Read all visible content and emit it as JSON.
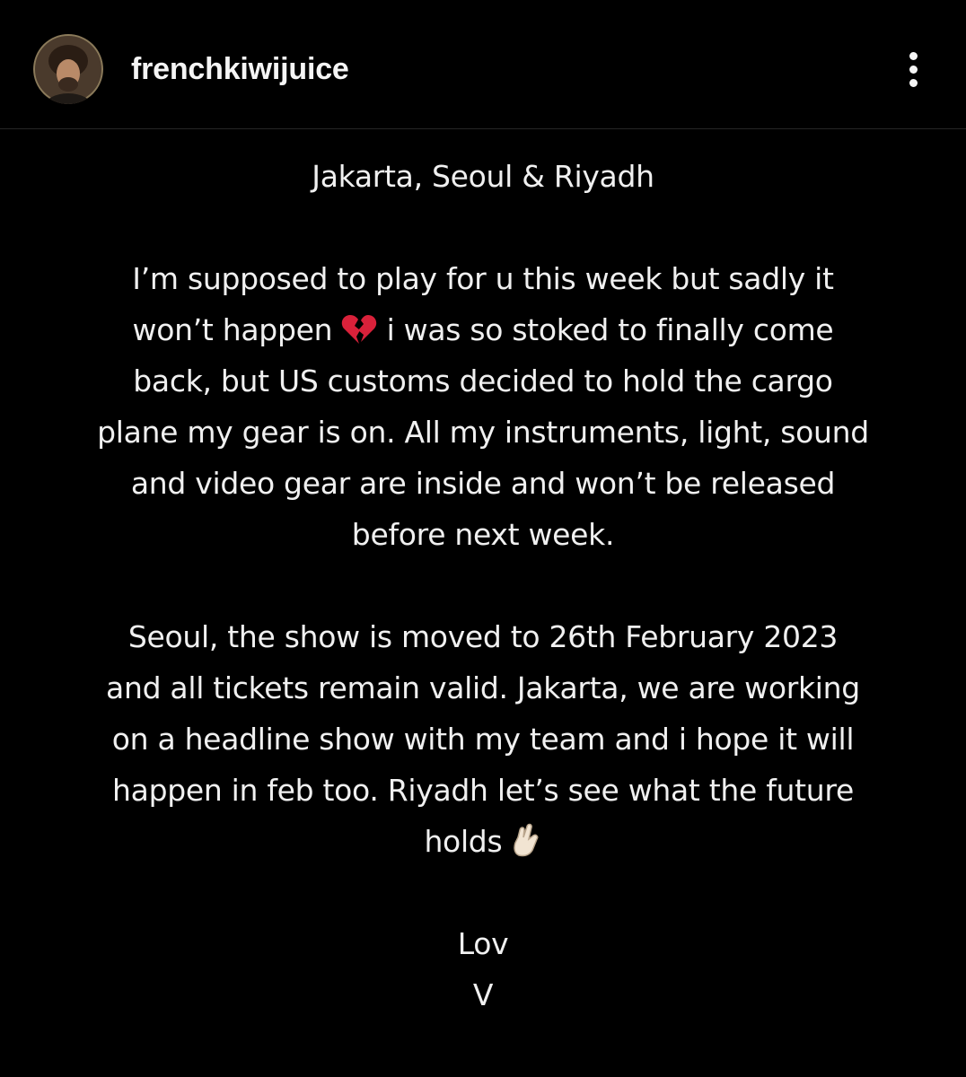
{
  "post": {
    "username": "frenchkiwijuice",
    "title": "Jakarta, Seoul & Riyadh",
    "paragraph1": [
      "I’m supposed to play for u this week but sadly it",
      "won’t happen",
      "i was so stoked to finally come",
      "back, but US customs decided to hold the cargo",
      "plane my gear is on. All my instruments, light, sound",
      "and video gear are inside and won’t be released",
      "before next week."
    ],
    "paragraph2": [
      "Seoul, the show is moved to 26th February 2023",
      "and all tickets remain valid. Jakarta, we are working",
      "on a headline show with my team and i hope it will",
      "happen in feb too. Riyadh let’s see what the future",
      "holds"
    ],
    "signoff": [
      "Lov",
      "V"
    ]
  },
  "icons": {
    "avatar": "profile-photo",
    "more": "more-vertical-icon",
    "broken_heart": "broken-heart-emoji",
    "crossed_fingers": "crossed-fingers-emoji"
  },
  "colors": {
    "background": "#000000",
    "text": "#f0f0f0",
    "divider": "#262626",
    "heart": "#d9213a"
  }
}
